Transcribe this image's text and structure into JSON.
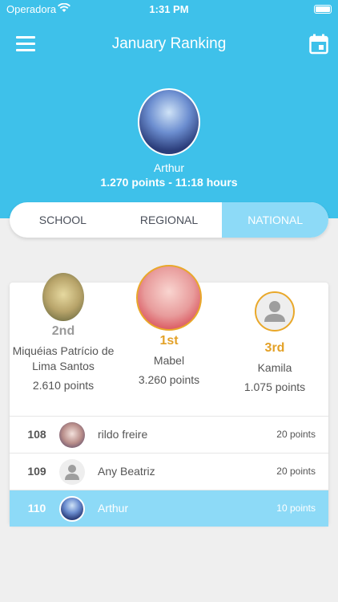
{
  "status_bar": {
    "carrier": "Operadora",
    "time": "1:31 PM"
  },
  "nav": {
    "title": "January Ranking",
    "menu_icon": "menu-icon",
    "calendar_icon": "calendar-icon"
  },
  "hero": {
    "name": "Arthur",
    "score": "1.270 points - 11:18 hours"
  },
  "segments": {
    "school": "SCHOOL",
    "regional": "REGIONAL",
    "national": "NATIONAL",
    "selected": "NATIONAL"
  },
  "podium": {
    "second": {
      "rank": "2nd",
      "name": "Miquéias Patrício de Lima Santos",
      "points": "2.610 points"
    },
    "first": {
      "rank": "1st",
      "name": "Mabel",
      "points": "3.260 points"
    },
    "third": {
      "rank": "3rd",
      "name": "Kamila",
      "points": "1.075 points"
    }
  },
  "ranking": [
    {
      "position": "108",
      "name": "rildo freire",
      "points": "20 points",
      "highlighted": false
    },
    {
      "position": "109",
      "name": "Any Beatriz",
      "points": "20 points",
      "highlighted": false
    },
    {
      "position": "110",
      "name": "Arthur",
      "points": "10 points",
      "highlighted": true
    }
  ],
  "colors": {
    "primary": "#3ec1ea",
    "highlight": "#8ddaf7",
    "gold": "#e3a127",
    "silver": "#9a9a9a"
  }
}
